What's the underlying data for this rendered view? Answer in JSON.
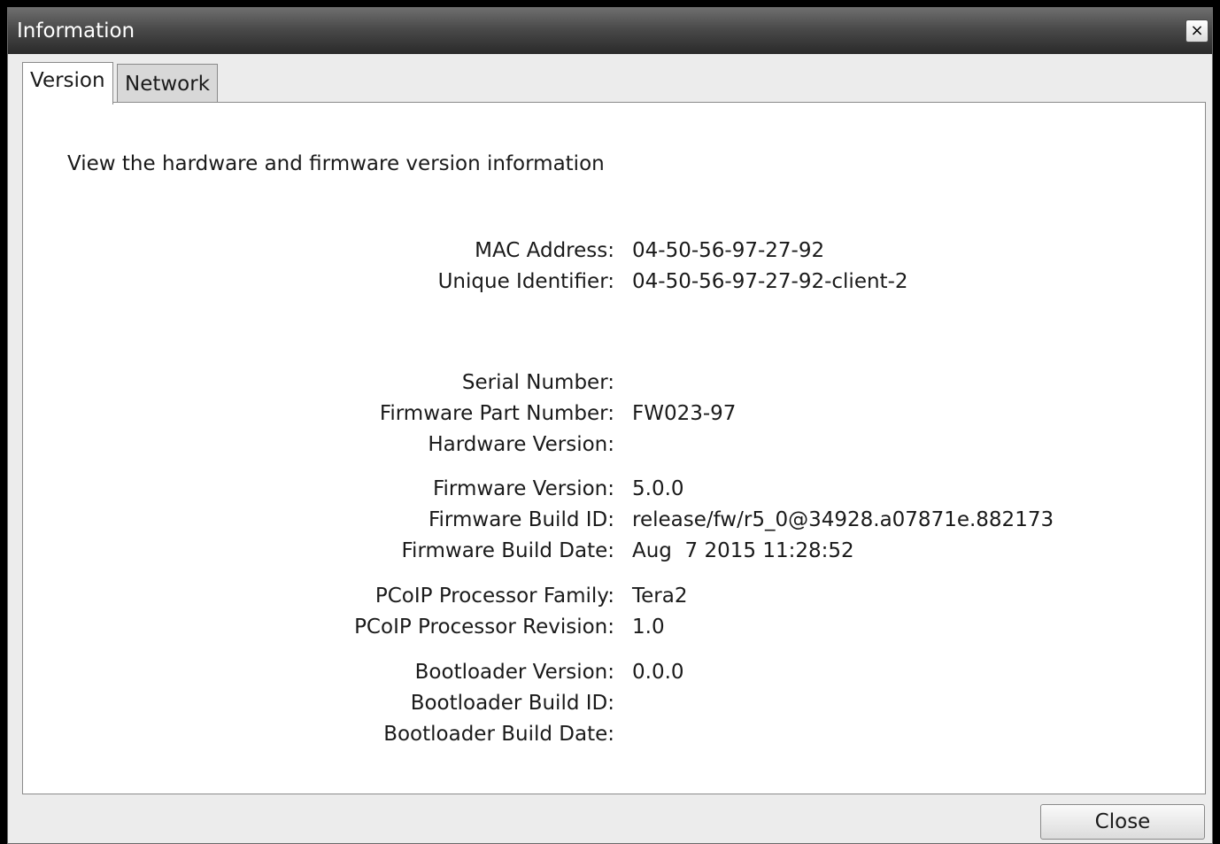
{
  "window": {
    "title": "Information",
    "close_icon": "×"
  },
  "tabs": [
    {
      "label": "Version",
      "active": true
    },
    {
      "label": "Network",
      "active": false
    }
  ],
  "panel": {
    "description": "View the hardware and firmware version information",
    "fields": [
      {
        "label": "MAC Address:",
        "value": "04-50-56-97-27-92"
      },
      {
        "label": "Unique Identifier:",
        "value": "04-50-56-97-27-92-client-2"
      },
      {
        "label": "Serial Number:",
        "value": ""
      },
      {
        "label": "Firmware Part Number:",
        "value": "FW023-97"
      },
      {
        "label": "Hardware Version:",
        "value": ""
      },
      {
        "label": "Firmware Version:",
        "value": "5.0.0"
      },
      {
        "label": "Firmware Build ID:",
        "value": "release/fw/r5_0@34928.a07871e.882173"
      },
      {
        "label": "Firmware Build Date:",
        "value": "Aug  7 2015 11:28:52"
      },
      {
        "label": "PCoIP Processor Family:",
        "value": "Tera2"
      },
      {
        "label": "PCoIP Processor Revision:",
        "value": "1.0"
      },
      {
        "label": "Bootloader Version:",
        "value": "0.0.0"
      },
      {
        "label": "Bootloader Build ID:",
        "value": ""
      },
      {
        "label": "Bootloader Build Date:",
        "value": ""
      }
    ]
  },
  "footer": {
    "close_label": "Close"
  }
}
